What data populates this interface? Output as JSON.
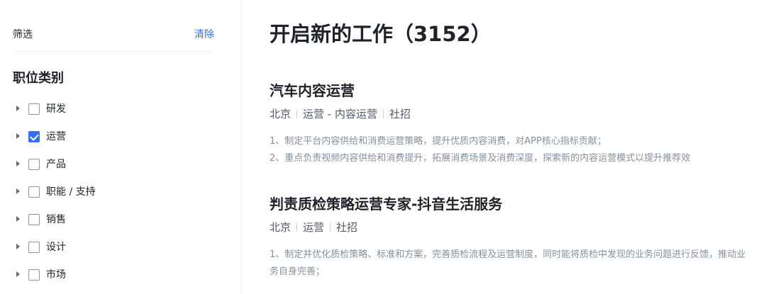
{
  "sidebar": {
    "filter_title": "筛选",
    "clear_label": "清除",
    "category_title": "职位类别",
    "categories": [
      {
        "label": "研发",
        "checked": false
      },
      {
        "label": "运营",
        "checked": true
      },
      {
        "label": "产品",
        "checked": false
      },
      {
        "label": "职能 / 支持",
        "checked": false
      },
      {
        "label": "销售",
        "checked": false
      },
      {
        "label": "设计",
        "checked": false
      },
      {
        "label": "市场",
        "checked": false
      }
    ]
  },
  "main": {
    "title": "开启新的工作（3152）",
    "jobs": [
      {
        "title": "汽车内容运营",
        "city": "北京",
        "category": "运营 - 内容运营",
        "type": "社招",
        "desc_1": "1、制定平台内容供给和消费运营策略，提升优质内容消费，对APP核心指标贡献；",
        "desc_2": "2、重点负责视频内容供给和消费提升，拓展消费场景及消费深度，探索新的内容运营模式以提升推荐效"
      },
      {
        "title": "判责质检策略运营专家-抖音生活服务",
        "city": "北京",
        "category": "运营",
        "type": "社招",
        "desc_1": "1、制定并优化质检策略、标准和方案，完善质检流程及运营制度，同时能将质检中发现的业务问题进行反馈，推动业务自身完善；"
      }
    ]
  },
  "colors": {
    "accent": "#3370ff",
    "text_primary": "#1f2329",
    "text_secondary": "#4e5969",
    "text_tertiary": "#86909c"
  }
}
